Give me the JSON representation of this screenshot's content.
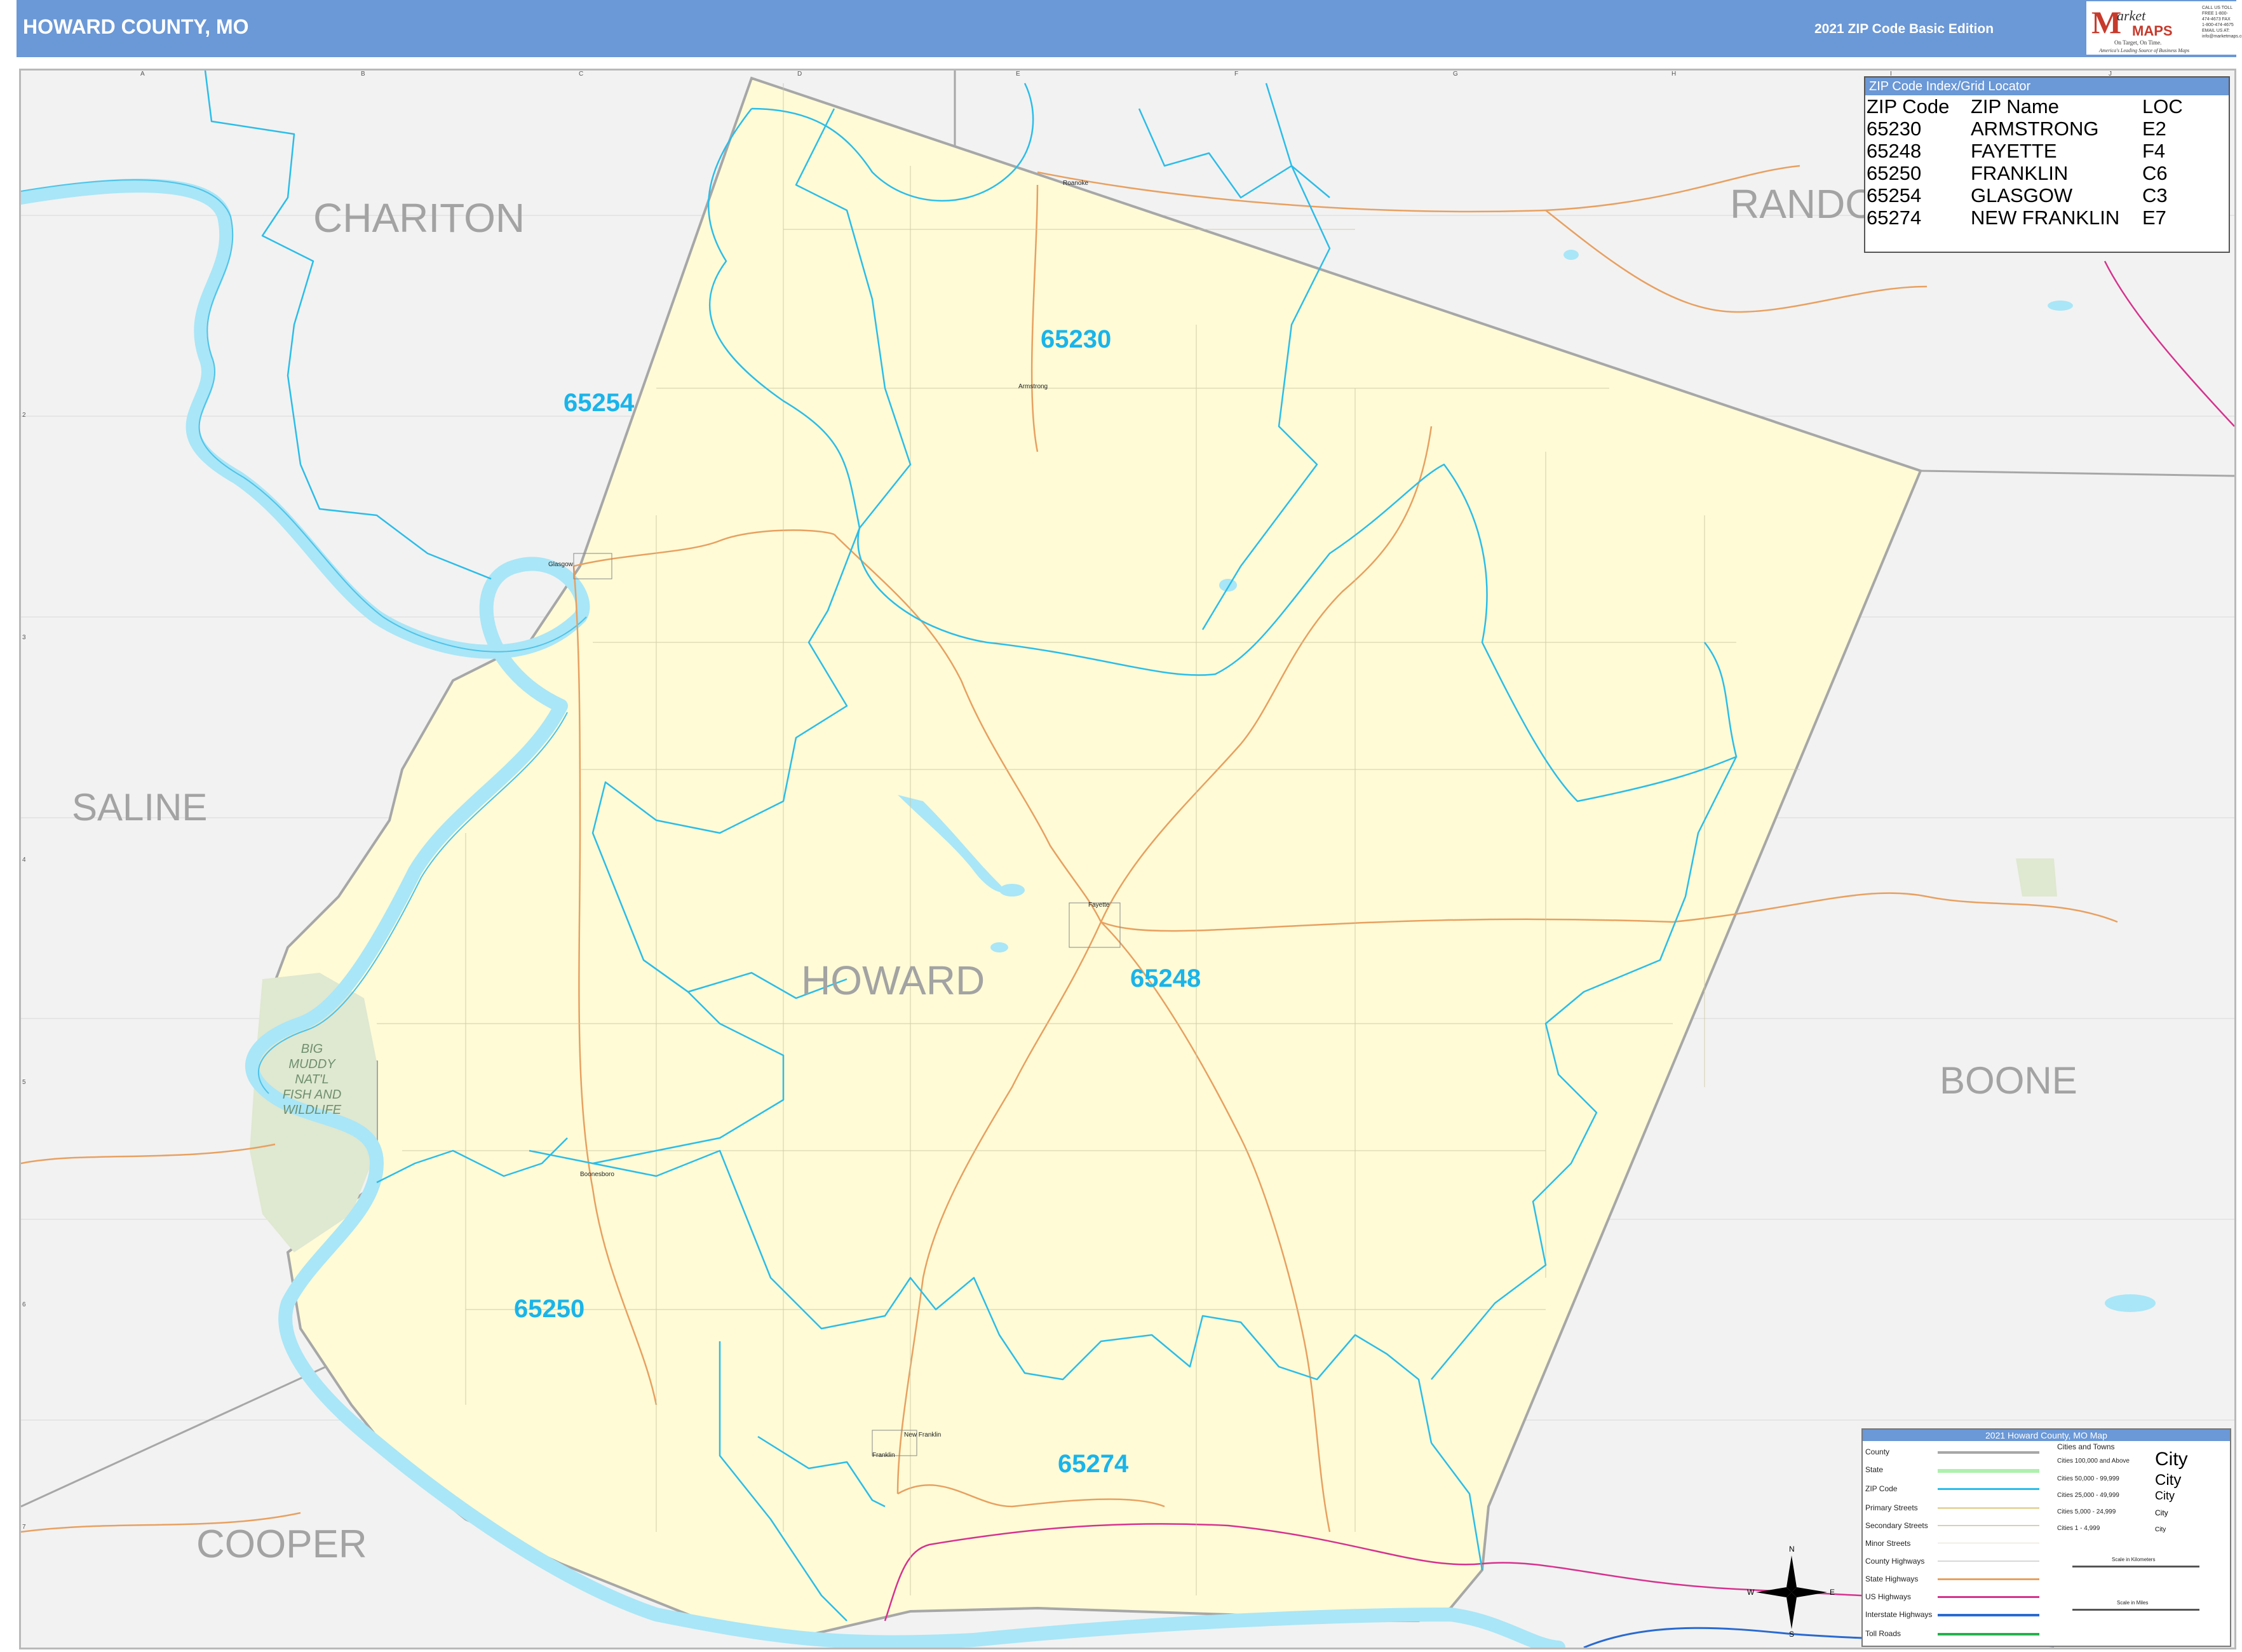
{
  "header": {
    "title": "HOWARD COUNTY, MO",
    "edition": "2021 ZIP Code Basic Edition",
    "logo_m": "M",
    "logo_arket": "arket",
    "logo_maps": "MAPS",
    "logo_tagline": "On Target, On Time.",
    "logo_tagline2": "America's Leading Source of Business Maps",
    "logo_contact": "CALL US TOLL FREE 1-800-474-4673 FAX 1-800-474-4675 EMAIL US AT: info@marketmaps.com"
  },
  "grid": {
    "columns": [
      "A",
      "B",
      "C",
      "D",
      "E",
      "F",
      "G",
      "H",
      "I",
      "J"
    ],
    "rows": [
      "1",
      "2",
      "3",
      "4",
      "5",
      "6",
      "7"
    ]
  },
  "counties": {
    "main": "HOWARD",
    "chariton": "CHARITON",
    "randolph_partial": "RANDO",
    "saline": "SALINE",
    "boone": "BOONE",
    "cooper": "COOPER"
  },
  "zip_labels": [
    "65230",
    "65254",
    "65248",
    "65250",
    "65274"
  ],
  "towns": [
    "Glasgow",
    "Armstrong",
    "Fayette",
    "Boonesboro",
    "New Franklin",
    "Franklin",
    "Roanoke"
  ],
  "park": {
    "line1": "BIG",
    "line2": "MUDDY",
    "line3": "NAT'L",
    "line4": "FISH AND",
    "line5": "WILDLIFE"
  },
  "index": {
    "title": "ZIP Code Index/Grid Locator",
    "headers": [
      "ZIP Code",
      "ZIP Name",
      "LOC"
    ],
    "rows": [
      [
        "65230",
        "ARMSTRONG",
        "E2"
      ],
      [
        "65248",
        "FAYETTE",
        "F4"
      ],
      [
        "65250",
        "FRANKLIN",
        "C6"
      ],
      [
        "65254",
        "GLASGOW",
        "C3"
      ],
      [
        "65274",
        "NEW FRANKLIN",
        "E7"
      ]
    ]
  },
  "legend": {
    "title": "2021 Howard County, MO Map",
    "items": [
      "County",
      "State",
      "ZIP Code",
      "Primary Streets",
      "Secondary Streets",
      "Minor Streets",
      "County Highways",
      "State Highways",
      "US Highways",
      "Interstate Highways",
      "Toll Roads"
    ],
    "cities_title": "Cities and Towns",
    "cities": [
      "Cities 100,000 and Above",
      "Cities 50,000 - 99,999",
      "Cities 25,000 - 49,999",
      "Cities 5,000 - 24,999",
      "Cities 1 - 4,999"
    ],
    "city_word": "City",
    "scale_km": "Scale in Kilometers",
    "scale_mi": "Scale in Miles"
  },
  "compass": {
    "n": "N",
    "s": "S",
    "e": "E",
    "w": "W"
  },
  "colors": {
    "header_blue": "#6b98d6",
    "county_fill": "#fefbd6",
    "outside_fill": "#f2f2f2",
    "river": "#a9e6f7",
    "zip_line": "#2bbde8",
    "county_line": "#a7a7a7",
    "state_hwy": "#e8a060",
    "us_hwy": "#d6328e",
    "interstate": "#2a6ad0",
    "park": "#dfe8d0"
  }
}
